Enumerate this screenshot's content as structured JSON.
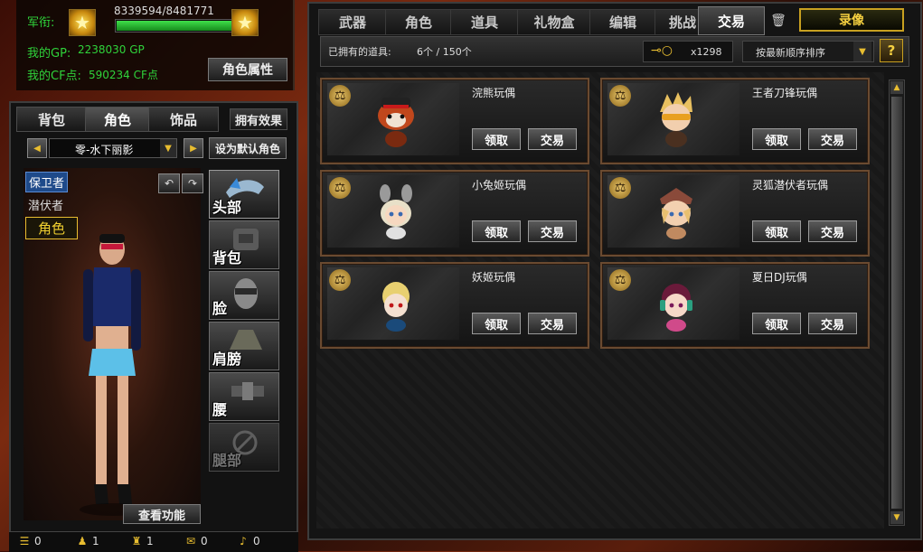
{
  "player": {
    "rank_label": "军衔:",
    "exp_text": "8339594/8481771",
    "exp_progress": 0.983,
    "gp_label": "我的GP:",
    "gp_value": "2238030 GP",
    "cf_label": "我的CF点:",
    "cf_value": "590234 CF点",
    "role_attr_button": "角色属性",
    "rank_icon": "gold-star-badge"
  },
  "left_tabs": [
    {
      "label": "背包",
      "active": false
    },
    {
      "label": "角色",
      "active": true
    },
    {
      "label": "饰品",
      "active": false
    },
    {
      "label": "拥有效果",
      "active": false
    }
  ],
  "character": {
    "selected": "零-水下丽影",
    "set_default_button": "设为默认角色",
    "factions": [
      "保卫者",
      "潜伏者",
      "角色"
    ],
    "slots": [
      "头部",
      "背包",
      "脸",
      "肩膀",
      "腰",
      "腿部"
    ],
    "view_function_button": "查看功能"
  },
  "main_tabs": [
    {
      "label": "武器",
      "active": false
    },
    {
      "label": "角色",
      "active": false
    },
    {
      "label": "道具",
      "active": false
    },
    {
      "label": "礼物盒",
      "active": false
    },
    {
      "label": "编辑",
      "active": false
    },
    {
      "label": "挑战",
      "active": false
    },
    {
      "label": "交易",
      "active": true
    }
  ],
  "record_button": "录像",
  "items_bar": {
    "owned_label": "已拥有的道具:",
    "owned_count": "6个 / 150个",
    "key_count": "x1298",
    "sort_label": "按最新顺序排序",
    "help": "?"
  },
  "items": [
    {
      "name": "浣熊玩偶",
      "claim": "领取",
      "trade": "交易",
      "icon": "red-panda-doll"
    },
    {
      "name": "王者刀锋玩偶",
      "claim": "领取",
      "trade": "交易",
      "icon": "blonde-sunglasses-doll"
    },
    {
      "name": "小兔姬玩偶",
      "claim": "领取",
      "trade": "交易",
      "icon": "bunny-girl-doll"
    },
    {
      "name": "灵狐潜伏者玩偶",
      "claim": "领取",
      "trade": "交易",
      "icon": "fox-cap-doll"
    },
    {
      "name": "妖姬玩偶",
      "claim": "领取",
      "trade": "交易",
      "icon": "blonde-girl-doll"
    },
    {
      "name": "夏日DJ玩偶",
      "claim": "领取",
      "trade": "交易",
      "icon": "dj-headphones-doll"
    }
  ],
  "bottom_stats": [
    {
      "icon": "list-icon",
      "value": "0"
    },
    {
      "icon": "person-icon",
      "value": "1"
    },
    {
      "icon": "team-icon",
      "value": "1"
    },
    {
      "icon": "chat-icon",
      "value": "0"
    },
    {
      "icon": "speaker-icon",
      "value": "0"
    }
  ],
  "colors": {
    "accent_gold": "#e8bd30",
    "green_text": "#2fd23a",
    "card_border": "#6a4a30"
  }
}
